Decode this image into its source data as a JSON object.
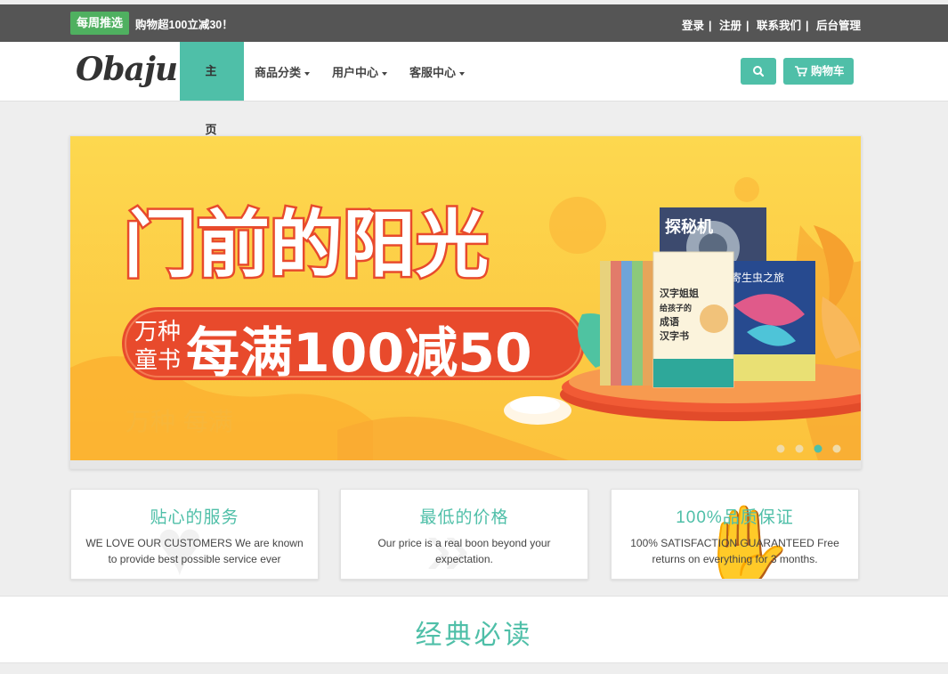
{
  "topbar": {
    "badge": "每周推选",
    "promo": "购物超100立减30！",
    "links": [
      "登录",
      "注册",
      "联系我们",
      "后台管理"
    ]
  },
  "navbar": {
    "logo": "Obaju",
    "home": "主　页",
    "menu": [
      "商品分类",
      "用户中心",
      "客服中心"
    ],
    "search_icon": "search-icon",
    "cart_label": "购物车",
    "cart_icon": "shopping-cart-icon"
  },
  "banner": {
    "headline": "门前的阳光",
    "tag_line1": "万种",
    "tag_line2": "童书",
    "offer": "每满100减50",
    "book_titles": [
      "汉字姐姐",
      "给孩子的",
      "成语",
      "汉字书",
      "探秘机",
      "寄生虫之旅"
    ],
    "carousel_total": 4,
    "carousel_active": 3
  },
  "features": [
    {
      "title": "贴心的服务",
      "text": "WE LOVE OUR CUSTOMERS We are known to provide best possible service ever",
      "icon": "heart-icon"
    },
    {
      "title": "最低的价格",
      "text": "Our price is a real boon beyond your expectation.",
      "icon": "tag-icon"
    },
    {
      "title": "100%品质保证",
      "text": "100% SATISFACTION GUARANTEED Free returns on everything for 3 months.",
      "icon": "thumbs-up-icon"
    }
  ],
  "section": {
    "title": "经典必读"
  },
  "colors": {
    "accent": "#4fbfa8",
    "topbar_bg": "#555555",
    "badge_green": "#4fb060",
    "banner_yellow": "#fcd04a",
    "banner_red": "#e84a2c"
  }
}
